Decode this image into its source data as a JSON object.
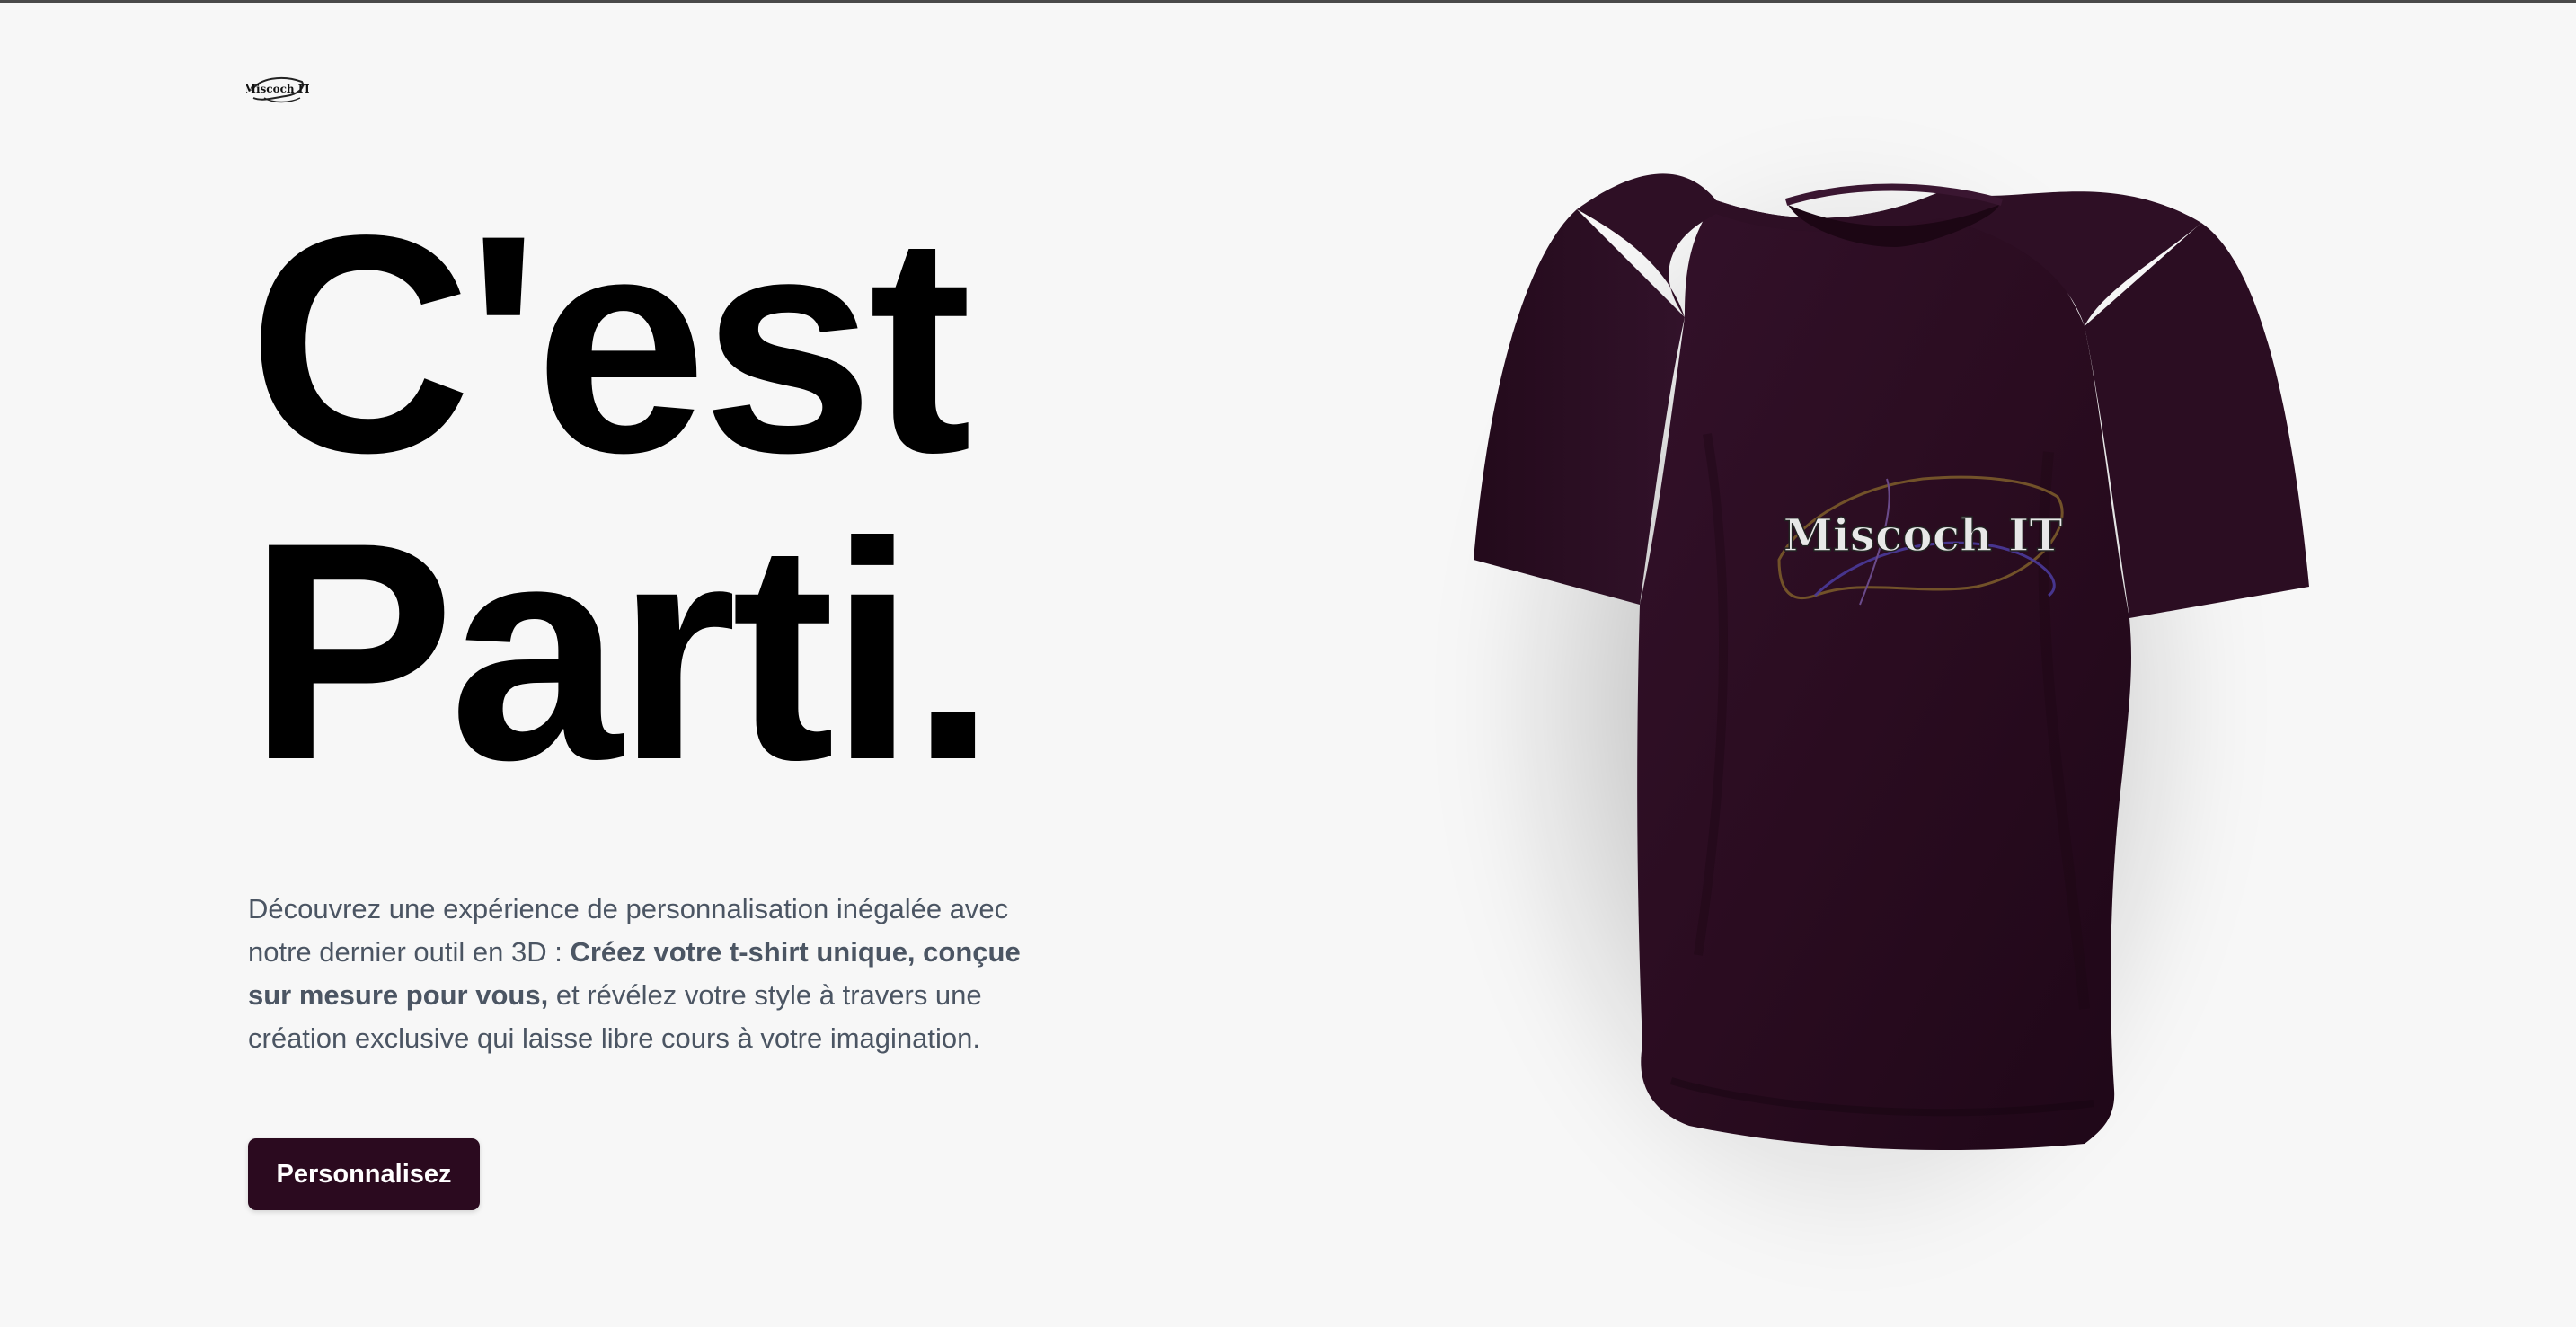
{
  "header": {
    "logo_text": "Miscoch IT",
    "logo_icon": "brand-logo-icon"
  },
  "hero": {
    "title_line1": "C'est",
    "title_line2": "Parti.",
    "intro_part1": "Découvrez une expérience de personnalisation inégalée avec notre dernier outil en 3D : ",
    "intro_bold": "Créez votre t-shirt unique, conçue sur mesure pour vous,",
    "intro_part2": " et révélez votre style à travers une création exclusive qui laisse libre cours à votre imagination.",
    "cta_label": "Personnalisez"
  },
  "shirt": {
    "print_text": "Miscoch IT",
    "color": "#2a0c1f",
    "icon": "tshirt-3d-preview"
  },
  "colors": {
    "background": "#f7f7f7",
    "accent": "#2b0a1f",
    "text_body": "#4b5563",
    "title": "#000000"
  }
}
